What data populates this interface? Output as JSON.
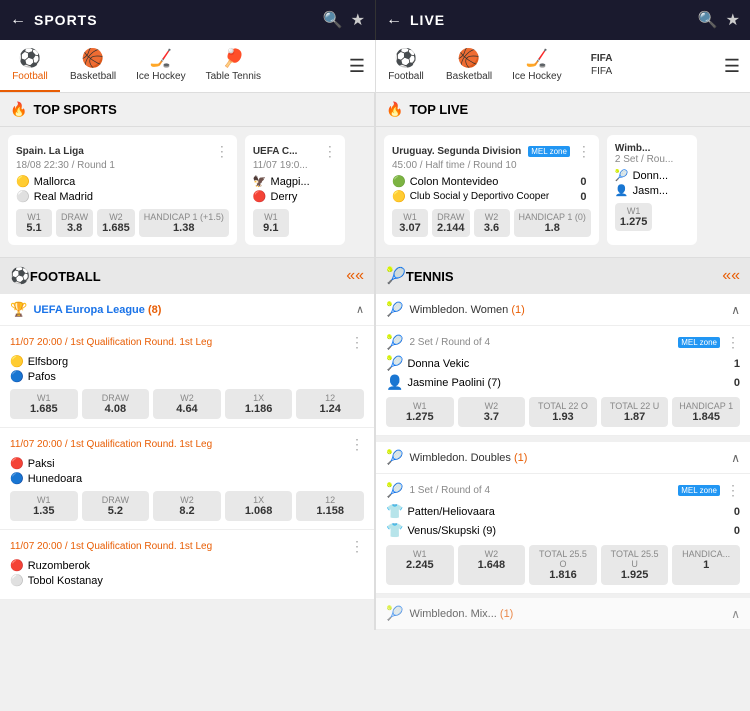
{
  "bars": {
    "sports_title": "SPORTS",
    "live_title": "LIVE",
    "back": "←",
    "search": "🔍",
    "star": "★"
  },
  "sports_tabs": [
    {
      "label": "Football",
      "icon": "⚽",
      "active": true
    },
    {
      "label": "Basketball",
      "icon": "🏀",
      "active": false
    },
    {
      "label": "Ice Hockey",
      "icon": "🏒",
      "active": false
    },
    {
      "label": "Table Tennis",
      "icon": "🏓",
      "active": false
    }
  ],
  "live_tabs": [
    {
      "label": "Football",
      "icon": "⚽",
      "active": false
    },
    {
      "label": "Basketball",
      "icon": "🏀",
      "active": false
    },
    {
      "label": "Ice Hockey",
      "icon": "🏒",
      "active": false
    },
    {
      "label": "FIFA",
      "icon": "FIFA",
      "active": false
    }
  ],
  "top_sports": {
    "title": "TOP SPORTS",
    "matches": [
      {
        "league": "Spain. La Liga",
        "time": "18/08 22:30 / Round 1",
        "team1": "Mallorca",
        "team2": "Real Madrid",
        "odds": [
          {
            "label": "W1",
            "val": "5.1"
          },
          {
            "label": "DRAW",
            "val": "3.8"
          },
          {
            "label": "W2",
            "val": "1.685"
          },
          {
            "label": "HANDICAP 1 (+1.5)",
            "val": "1.38"
          }
        ]
      },
      {
        "league": "UEFA C...",
        "time": "11/07 19:0...",
        "team1": "Magpi...",
        "team2": "Derry",
        "odds": [
          {
            "label": "W1",
            "val": "9.1"
          }
        ]
      }
    ]
  },
  "top_live": {
    "title": "TOP LIVE",
    "matches": [
      {
        "league": "Uruguay. Segunda Division",
        "time": "45:00 / Half time / Round 10",
        "team1": "Colon Montevideo",
        "team2": "Club Social y Deportivo Cooper",
        "score1": "0",
        "score2": "0",
        "odds": [
          {
            "label": "W1",
            "val": "3.07"
          },
          {
            "label": "DRAW",
            "val": "2.144"
          },
          {
            "label": "W2",
            "val": "3.6"
          },
          {
            "label": "HANDICAP 1 (0)",
            "val": "1.8"
          }
        ]
      },
      {
        "league": "Wimb...",
        "time": "2 Set / Rou...",
        "team1": "Donn...",
        "team2": "Jasm...",
        "odds": [
          {
            "label": "W1",
            "val": "1.275"
          }
        ]
      }
    ]
  },
  "football": {
    "section_title": "FOOTBALL",
    "leagues": [
      {
        "name": "UEFA Europa League",
        "count": "(8)",
        "matches": [
          {
            "time": "11/07 20:00 / 1st Qualification Round. 1st Leg",
            "team1": "Elfsborg",
            "team1_icon": "🟡",
            "team2": "Pafos",
            "team2_icon": "🔵",
            "odds": [
              {
                "label": "W1",
                "val": "1.685"
              },
              {
                "label": "DRAW",
                "val": "4.08"
              },
              {
                "label": "W2",
                "val": "4.64"
              },
              {
                "label": "1X",
                "val": "1.186"
              },
              {
                "label": "12",
                "val": "1.24"
              }
            ]
          },
          {
            "time": "11/07 20:00 / 1st Qualification Round. 1st Leg",
            "team1": "Paksi",
            "team1_icon": "🔴",
            "team2": "Hunedoara",
            "team2_icon": "🔵",
            "odds": [
              {
                "label": "W1",
                "val": "1.35"
              },
              {
                "label": "DRAW",
                "val": "5.2"
              },
              {
                "label": "W2",
                "val": "8.2"
              },
              {
                "label": "1X",
                "val": "1.068"
              },
              {
                "label": "12",
                "val": "1.158"
              }
            ]
          },
          {
            "time": "11/07 20:00 / 1st Qualification Round. 1st Leg",
            "team1": "Ruzomberok",
            "team1_icon": "🔴",
            "team2": "Tobol Kostanay",
            "team2_icon": "⚪",
            "odds": []
          }
        ]
      }
    ]
  },
  "tennis": {
    "section_title": "TENNIS",
    "leagues": [
      {
        "name": "Wimbledon. Women",
        "count": "(1)",
        "matches": [
          {
            "round": "2 Set / Round of 4",
            "team1": "Donna Vekic",
            "team1_icon": "🎾",
            "score1": "1",
            "team2": "Jasmine Paolini (7)",
            "team2_icon": "👤",
            "score2": "0",
            "odds": [
              {
                "label": "W1",
                "val": "1.275"
              },
              {
                "label": "W2",
                "val": "3.7"
              },
              {
                "label": "TOTAL 22 O",
                "val": "1.93"
              },
              {
                "label": "TOTAL 22 U",
                "val": "1.87"
              },
              {
                "label": "HANDICAP 1",
                "val": "1.845"
              }
            ]
          }
        ]
      },
      {
        "name": "Wimbledon. Doubles",
        "count": "(1)",
        "matches": [
          {
            "round": "1 Set / Round of 4",
            "team1": "Patten/Heliovaara",
            "team1_icon": "👕",
            "score1": "0",
            "team2": "Venus/Skupski (9)",
            "team2_icon": "👕",
            "score2": "0",
            "odds": [
              {
                "label": "W1",
                "val": "2.245"
              },
              {
                "label": "W2",
                "val": "1.648"
              },
              {
                "label": "TOTAL 25.5 O",
                "val": "1.816"
              },
              {
                "label": "TOTAL 25.5 U",
                "val": "1.925"
              },
              {
                "label": "HANDICA...",
                "val": "1"
              }
            ]
          }
        ]
      }
    ]
  },
  "labels": {
    "mel_zone": "MEL zone",
    "dots": "⋮",
    "collapse_up": "▲",
    "collapse_dbl": "≫",
    "chevron_up": "∧",
    "menu": "≡"
  }
}
